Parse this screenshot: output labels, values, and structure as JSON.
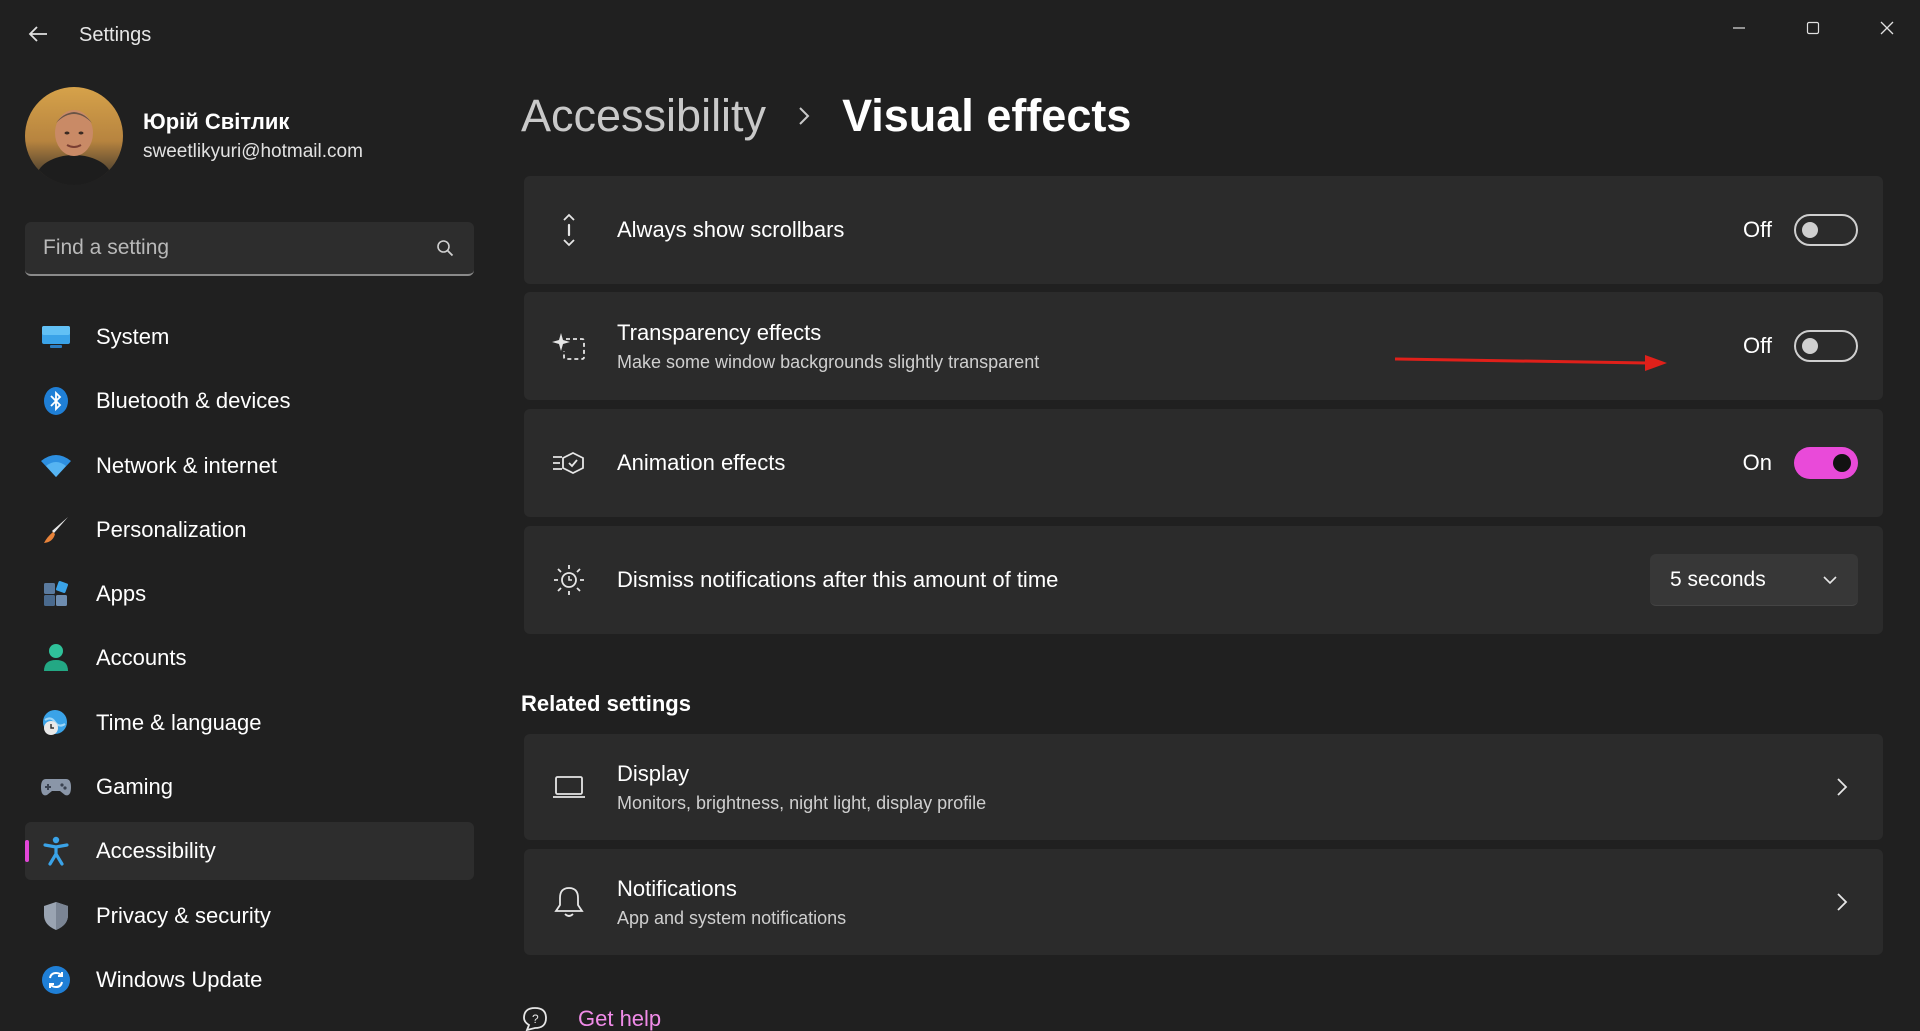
{
  "window": {
    "title": "Settings",
    "back_glyph": "←",
    "controls": [
      "minimize",
      "maximize",
      "close"
    ]
  },
  "profile": {
    "name": "Юрій Світлик",
    "email": "sweetlikyuri@hotmail.com"
  },
  "search": {
    "placeholder": "Find a setting"
  },
  "sidebar": {
    "items": [
      {
        "label": "System",
        "icon": "monitor-icon"
      },
      {
        "label": "Bluetooth & devices",
        "icon": "bluetooth-icon"
      },
      {
        "label": "Network & internet",
        "icon": "wifi-icon"
      },
      {
        "label": "Personalization",
        "icon": "brush-icon"
      },
      {
        "label": "Apps",
        "icon": "apps-icon"
      },
      {
        "label": "Accounts",
        "icon": "person-icon"
      },
      {
        "label": "Time & language",
        "icon": "globe-clock-icon"
      },
      {
        "label": "Gaming",
        "icon": "gamepad-icon"
      },
      {
        "label": "Accessibility",
        "icon": "accessibility-icon",
        "active": true
      },
      {
        "label": "Privacy & security",
        "icon": "shield-icon"
      },
      {
        "label": "Windows Update",
        "icon": "update-icon"
      }
    ]
  },
  "breadcrumb": {
    "parent": "Accessibility",
    "current": "Visual effects"
  },
  "settings": {
    "scrollbars": {
      "title": "Always show scrollbars",
      "state_label": "Off",
      "on": false
    },
    "transparency": {
      "title": "Transparency effects",
      "subtitle": "Make some window backgrounds slightly transparent",
      "state_label": "Off",
      "on": false
    },
    "animation": {
      "title": "Animation effects",
      "state_label": "On",
      "on": true
    },
    "notifications_time": {
      "title": "Dismiss notifications after this amount of time",
      "value": "5 seconds"
    }
  },
  "related": {
    "title": "Related settings",
    "display": {
      "title": "Display",
      "subtitle": "Monitors, brightness, night light, display profile"
    },
    "notifications": {
      "title": "Notifications",
      "subtitle": "App and system notifications"
    }
  },
  "help": {
    "label": "Get help"
  },
  "colors": {
    "background": "#202020",
    "card": "#2b2b2b",
    "accent": "#e94ad9",
    "annotation_arrow": "#e0201a"
  }
}
